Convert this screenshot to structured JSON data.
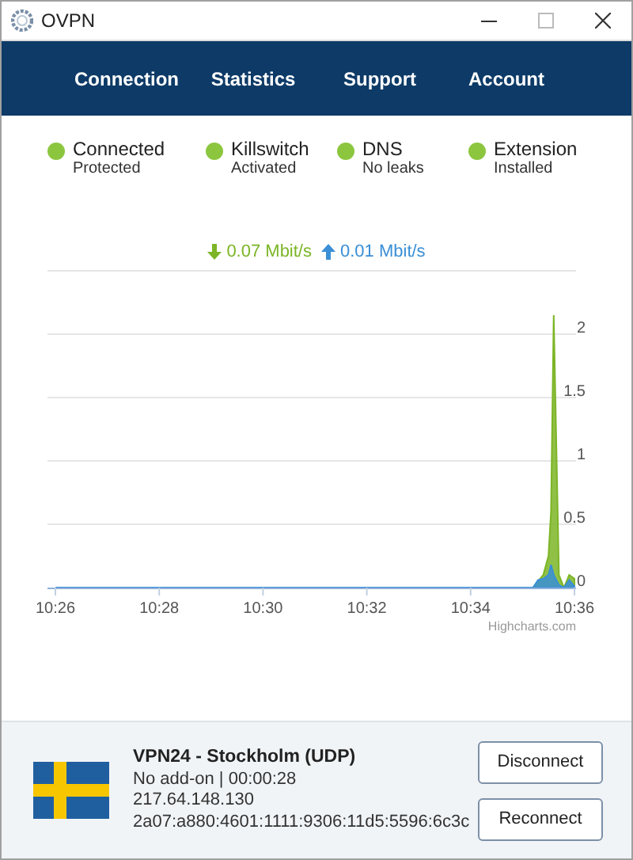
{
  "window": {
    "title": "OVPN"
  },
  "nav": [
    {
      "label": "Connection"
    },
    {
      "label": "Statistics"
    },
    {
      "label": "Support"
    },
    {
      "label": "Account"
    }
  ],
  "status": [
    {
      "title": "Connected",
      "detail": "Protected",
      "color": "#8cc63f"
    },
    {
      "title": "Killswitch",
      "detail": "Activated",
      "color": "#8cc63f"
    },
    {
      "title": "DNS",
      "detail": "No leaks",
      "color": "#8cc63f"
    },
    {
      "title": "Extension",
      "detail": "Installed",
      "color": "#8cc63f"
    }
  ],
  "speeds": {
    "down": "0.07 Mbit/s",
    "up": "0.01 Mbit/s"
  },
  "chart_data": {
    "type": "area",
    "x": [
      626,
      635.2,
      635.3,
      635.4,
      635.5,
      635.55,
      635.6,
      635.7,
      635.8,
      635.9,
      636
    ],
    "series": [
      {
        "color": "#7cb526",
        "values": [
          0,
          0,
          0.05,
          0.1,
          0.25,
          0.6,
          2.15,
          0.1,
          0,
          0.1,
          0.07
        ]
      },
      {
        "color": "#3a8fd6",
        "values": [
          0,
          0,
          0.06,
          0.07,
          0.1,
          0.18,
          0.1,
          0.02,
          0,
          0.06,
          0.01
        ]
      }
    ],
    "xlim": [
      626,
      636
    ],
    "ylim": [
      0,
      2.5
    ],
    "xticks": [
      {
        "value": 626,
        "label": "10:26"
      },
      {
        "value": 628,
        "label": "10:28"
      },
      {
        "value": 630,
        "label": "10:30"
      },
      {
        "value": 632,
        "label": "10:32"
      },
      {
        "value": 634,
        "label": "10:34"
      },
      {
        "value": 636,
        "label": "10:36"
      }
    ],
    "yticks": [
      {
        "value": 0,
        "label": "0"
      },
      {
        "value": 0.5,
        "label": "0.5"
      },
      {
        "value": 1,
        "label": "1"
      },
      {
        "value": 1.5,
        "label": "1.5"
      },
      {
        "value": 2,
        "label": "2"
      }
    ],
    "grid": true
  },
  "chart_credit": "Highcharts.com",
  "connection": {
    "server": "VPN24 - Stockholm (UDP)",
    "addon": "No add-on | 00:00:28",
    "ipv4": "217.64.148.130",
    "ipv6": "2a07:a880:4601:1111:9306:11d5:5596:6c3c"
  },
  "buttons": [
    {
      "label": "Disconnect"
    },
    {
      "label": "Reconnect"
    }
  ]
}
